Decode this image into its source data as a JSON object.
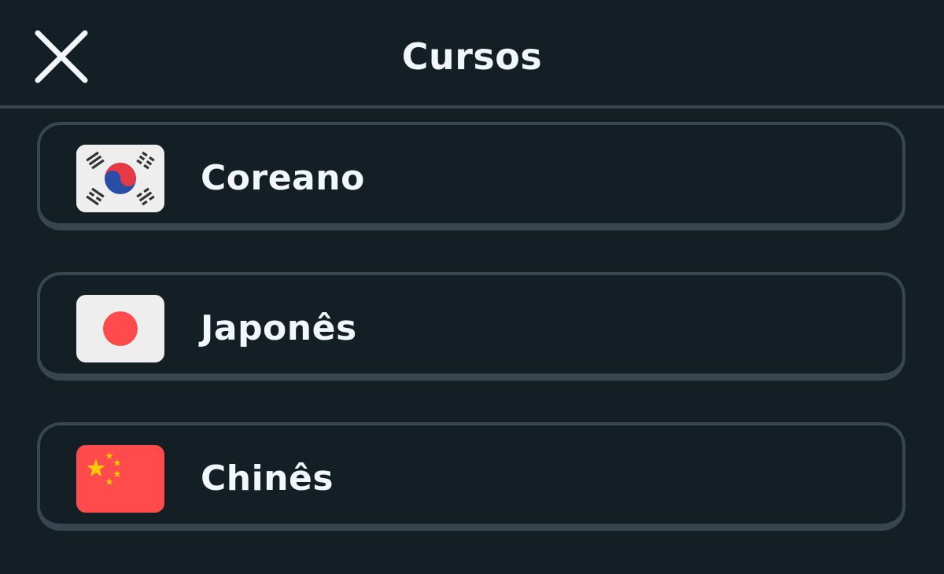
{
  "header": {
    "title": "Cursos",
    "close_icon": "close-icon"
  },
  "courses": [
    {
      "label": "Coreano",
      "flag_icon": "south-korea-flag-icon"
    },
    {
      "label": "Japonês",
      "flag_icon": "japan-flag-icon"
    },
    {
      "label": "Chinês",
      "flag_icon": "china-flag-icon"
    }
  ],
  "colors": {
    "background": "#131f24",
    "border": "#37464f",
    "text": "#f1f7fb",
    "flag_red": "#ff4b4b"
  }
}
